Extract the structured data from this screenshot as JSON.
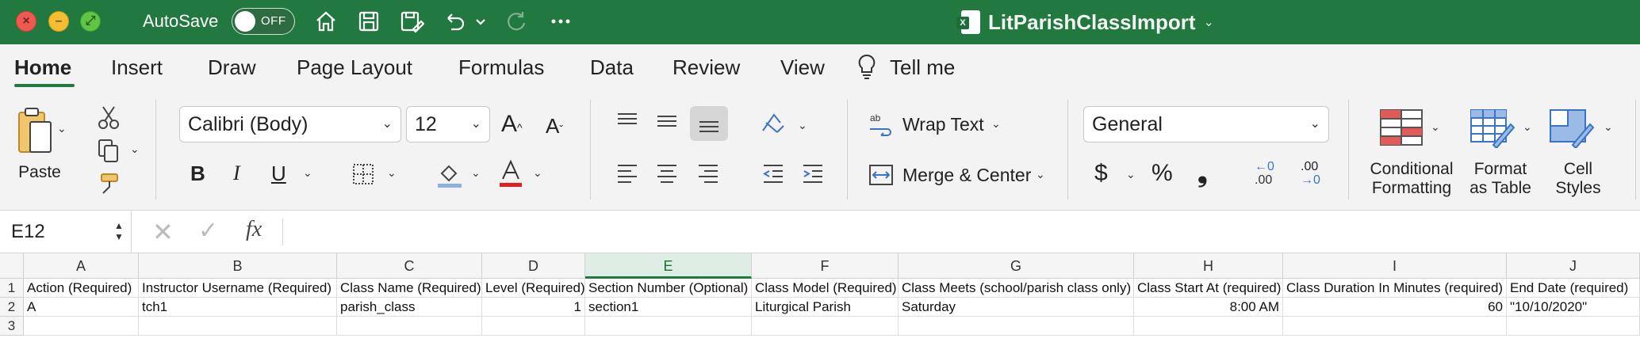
{
  "window": {
    "autosave_label": "AutoSave",
    "autosave_state": "OFF",
    "doc_title": "LitParishClassImport",
    "accent_color": "#21793f"
  },
  "tabs": [
    "Home",
    "Insert",
    "Draw",
    "Page Layout",
    "Formulas",
    "Data",
    "Review",
    "View",
    "Tell me"
  ],
  "ribbon": {
    "paste_label": "Paste",
    "font_name": "Calibri (Body)",
    "font_size": "12",
    "wrap_text": "Wrap Text",
    "merge_center": "Merge & Center",
    "number_format": "General",
    "conditional_formatting": [
      "Conditional",
      "Formatting"
    ],
    "format_as_table": [
      "Format",
      "as Table"
    ],
    "cell_styles": [
      "Cell",
      "Styles"
    ],
    "bold": "B",
    "italic": "I",
    "underline": "U",
    "currency": "$",
    "percent": "%",
    "comma": "❟",
    "inc_decimal_top": "←0",
    "inc_decimal_bot": ".00",
    "dec_decimal_top": ".00",
    "dec_decimal_bot": "→0"
  },
  "formula_bar": {
    "name_box": "E12",
    "formula": ""
  },
  "sheet": {
    "columns": [
      "A",
      "B",
      "C",
      "D",
      "E",
      "F",
      "G",
      "H",
      "I",
      "J"
    ],
    "selected_column": "E",
    "rows": [
      {
        "num": "1",
        "cells": [
          "Action (Required)",
          "Instructor Username (Required)",
          "Class Name (Required)",
          "Level (Required)",
          "Section Number (Optional)",
          "Class Model (Required)",
          "Class Meets (school/parish class only)",
          "Class Start At (required)",
          "Class Duration In Minutes (required)",
          "End Date (required)"
        ]
      },
      {
        "num": "2",
        "cells": [
          "A",
          "tch1",
          "parish_class",
          "1",
          "section1",
          "Liturgical Parish",
          "Saturday",
          "8:00 AM",
          "60",
          "\"10/10/2020\""
        ]
      },
      {
        "num": "3",
        "cells": [
          "",
          "",
          "",
          "",
          "",
          "",
          "",
          "",
          "",
          ""
        ]
      }
    ]
  }
}
